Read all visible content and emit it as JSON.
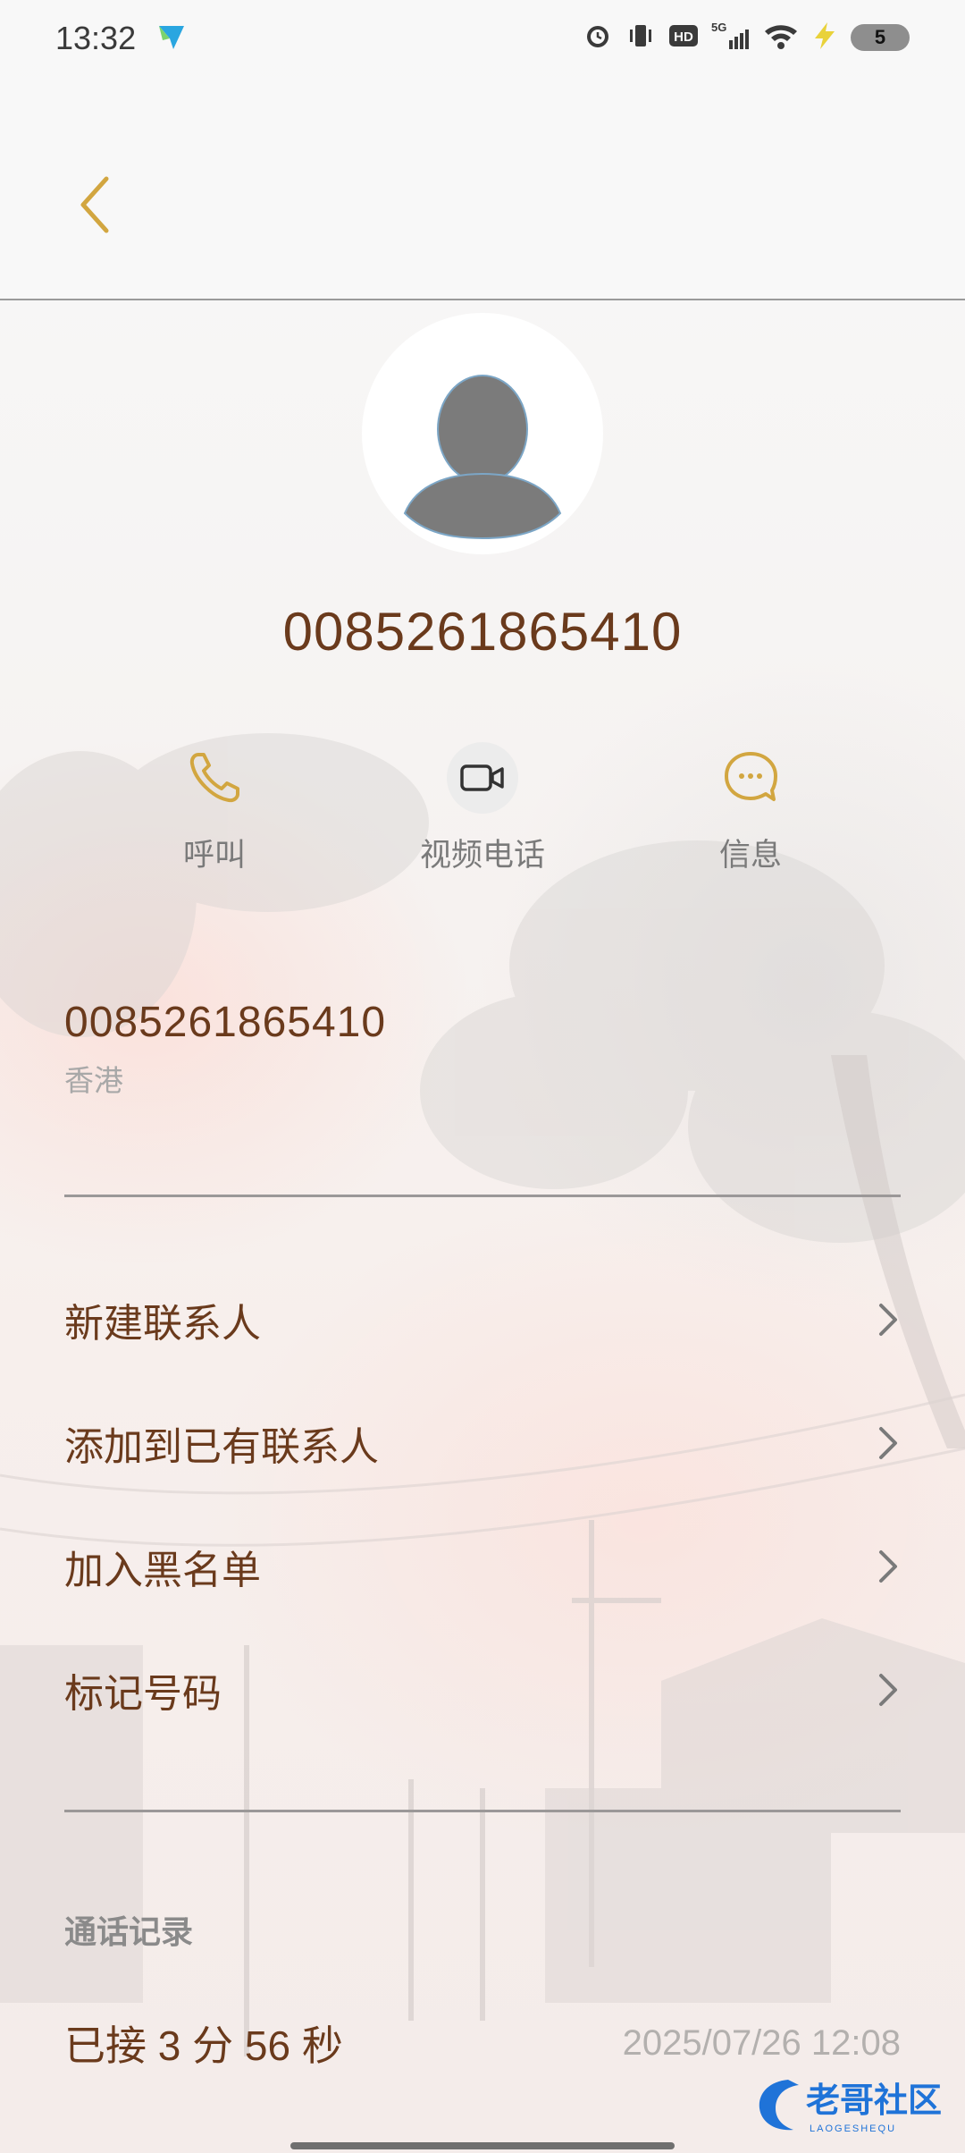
{
  "status_bar": {
    "time": "13:32",
    "network_label": "5G",
    "hd_label": "HD",
    "battery_level": "5",
    "icons": [
      "alarm-icon",
      "vibrate-icon",
      "hd-icon",
      "signal-icon",
      "wifi-icon",
      "charging-icon",
      "battery-icon"
    ]
  },
  "header": {
    "back_icon": "chevron-left-icon"
  },
  "contact": {
    "name": "0085261865410",
    "avatar_icon": "person-placeholder-icon"
  },
  "actions": [
    {
      "label": "呼叫",
      "icon": "phone-icon"
    },
    {
      "label": "视频电话",
      "icon": "video-camera-icon"
    },
    {
      "label": "信息",
      "icon": "message-bubble-icon"
    }
  ],
  "number": {
    "value": "0085261865410",
    "region": "香港"
  },
  "menu": [
    {
      "label": "新建联系人"
    },
    {
      "label": "添加到已有联系人"
    },
    {
      "label": "加入黑名单"
    },
    {
      "label": "标记号码"
    }
  ],
  "call_log": {
    "title": "通话记录",
    "records": [
      {
        "status": "已接 3 分 56 秒",
        "time": "2025/07/26 12:08"
      }
    ]
  },
  "watermark": {
    "text": "老哥社区",
    "subtext": "LAOGESHEQU"
  },
  "colors": {
    "accent": "#d2a640",
    "text_brown": "#6a3a1c",
    "muted": "#a8a8a8"
  }
}
